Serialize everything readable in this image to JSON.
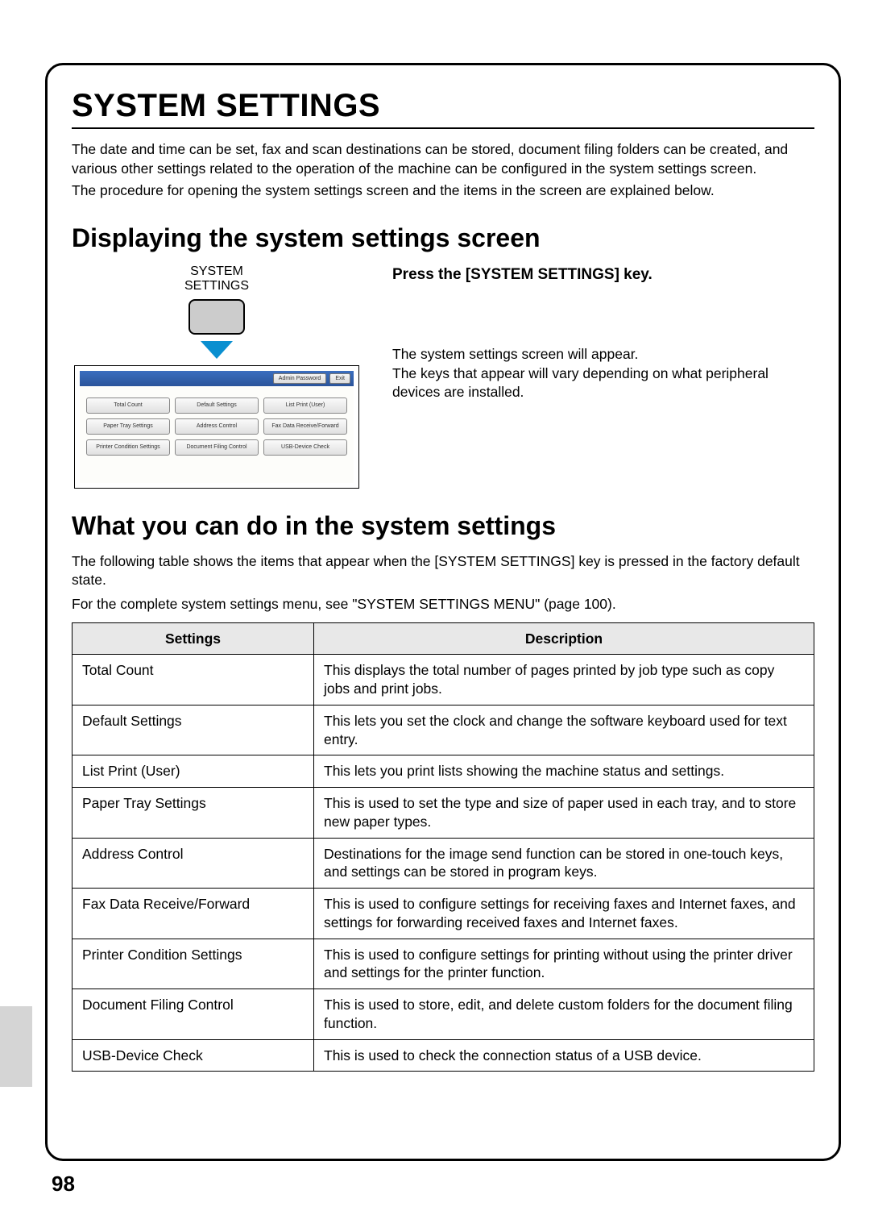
{
  "page_title": "SYSTEM SETTINGS",
  "intro_p1": "The date and time can be set, fax and scan destinations can be stored, document filing folders can be created, and various other settings related to the operation of the machine can be configured in the system settings screen.",
  "intro_p2": "The procedure for opening the system settings screen and the items in the screen are explained below.",
  "section1_title": "Displaying the system settings screen",
  "key_label_line1": "SYSTEM",
  "key_label_line2": "SETTINGS",
  "panel_top": {
    "admin_pw": "Admin Password",
    "exit": "Exit"
  },
  "panel_buttons": [
    "Total Count",
    "Default Settings",
    "List Print (User)",
    "Paper Tray Settings",
    "Address Control",
    "Fax Data Receive/Forward",
    "Printer Condition Settings",
    "Document Filing Control",
    "USB-Device Check"
  ],
  "press_heading": "Press the [SYSTEM SETTINGS] key.",
  "appear_p1": "The system settings screen will appear.",
  "appear_p2": "The keys that appear will vary depending on what peripheral devices are installed.",
  "section2_title": "What you can do in the system settings",
  "table_intro_p1": "The following table shows the items that appear when the [SYSTEM SETTINGS] key is pressed in the factory default state.",
  "table_intro_p2": "For the complete system settings menu, see \"SYSTEM SETTINGS MENU\" (page 100).",
  "table_headers": {
    "col1": "Settings",
    "col2": "Description"
  },
  "table_rows": [
    {
      "setting": "Total Count",
      "desc": "This displays the total number of pages printed by job type such as copy jobs and print jobs."
    },
    {
      "setting": "Default Settings",
      "desc": "This lets you set the clock and change the software keyboard used for text entry."
    },
    {
      "setting": "List Print (User)",
      "desc": "This lets you print lists showing the machine status and settings."
    },
    {
      "setting": "Paper Tray Settings",
      "desc": "This is used to set the type and size of paper used in each tray, and to store new paper types."
    },
    {
      "setting": "Address Control",
      "desc": "Destinations for the image send function can be stored in one-touch keys, and settings can be stored in program keys."
    },
    {
      "setting": "Fax Data Receive/Forward",
      "desc": "This is used to configure settings for receiving faxes and Internet faxes, and settings for forwarding received faxes and Internet faxes."
    },
    {
      "setting": "Printer Condition Settings",
      "desc": "This is used to configure settings for printing without using the printer driver and settings for the printer function."
    },
    {
      "setting": "Document Filing Control",
      "desc": "This is used to store, edit, and delete custom folders for the document filing function."
    },
    {
      "setting": "USB-Device Check",
      "desc": "This is used to check the connection status of a USB device."
    }
  ],
  "page_number": "98"
}
